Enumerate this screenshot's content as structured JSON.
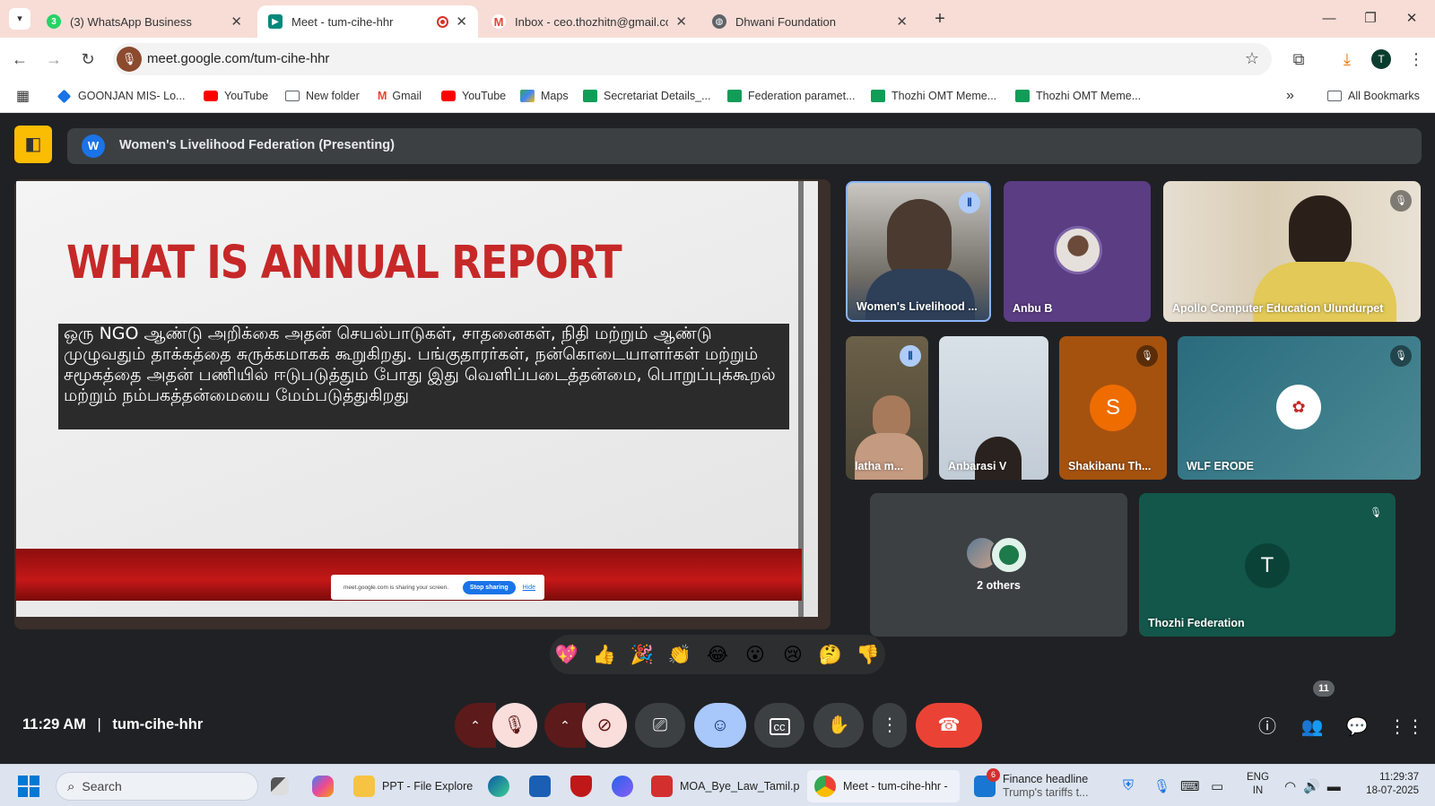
{
  "browser": {
    "tabs": [
      {
        "title": "(3) WhatsApp Business",
        "icon": "whatsapp-icon",
        "color": "#25d366",
        "badge": "3"
      },
      {
        "title": "Meet - tum-cihe-hhr",
        "icon": "google-meet-icon",
        "color": "#00897b"
      },
      {
        "title": "Inbox - ceo.thozhitn@gmail.com",
        "icon": "gmail-icon",
        "color": "#ea4335"
      },
      {
        "title": "Dhwani Foundation",
        "icon": "globe-icon",
        "color": "#5f6368"
      }
    ],
    "url": "meet.google.com/tum-cihe-hhr",
    "profile_initial": "T",
    "bookmarks": [
      {
        "label": "GOONJAN MIS- Lo...",
        "icon": "goonjan-icon",
        "color": "#1a73e8"
      },
      {
        "label": "YouTube",
        "icon": "youtube-icon",
        "color": "#ff0000"
      },
      {
        "label": "New folder",
        "icon": "folder-icon",
        "color": "#5f6368"
      },
      {
        "label": "Gmail",
        "icon": "gmail-icon",
        "color": "#ea4335"
      },
      {
        "label": "YouTube",
        "icon": "youtube-icon",
        "color": "#ff0000"
      },
      {
        "label": "Maps",
        "icon": "maps-icon",
        "color": "#34a853"
      },
      {
        "label": "Secretariat Details_...",
        "icon": "sheets-icon",
        "color": "#0f9d58"
      },
      {
        "label": "Federation paramet...",
        "icon": "sheets-icon",
        "color": "#0f9d58"
      },
      {
        "label": "Thozhi OMT Meme...",
        "icon": "sheets-icon",
        "color": "#0f9d58"
      },
      {
        "label": "Thozhi OMT Meme...",
        "icon": "sheets-icon",
        "color": "#0f9d58"
      }
    ],
    "all_bookmarks": "All Bookmarks"
  },
  "meet": {
    "presenter_initial": "W",
    "presenter_label": "Women's Livelihood Federation (Presenting)",
    "slide": {
      "title": "WHAT IS ANNUAL REPORT",
      "body": "ஒரு NGO ஆண்டு அறிக்கை அதன் செயல்பாடுகள், சாதனைகள், நிதி மற்றும் ஆண்டு முழுவதும் தாக்கத்தை சுருக்கமாகக் கூறுகிறது. பங்குதாரர்கள், நன்கொடையாளர்கள் மற்றும் சமூகத்தை அதன் பணியில் ஈடுபடுத்தும் போது இது வெளிப்படைத்தன்மை, பொறுப்புக்கூறல் மற்றும் நம்பகத்தன்மையை மேம்படுத்துகிறது",
      "share_notice": "meet.google.com is sharing your screen.",
      "stop_sharing": "Stop sharing",
      "hide": "Hide"
    },
    "participants": [
      {
        "name": "Women's Livelihood ...",
        "state": "speaking"
      },
      {
        "name": "Anbu B",
        "state": "none"
      },
      {
        "name": "Apollo Computer Education Ulundurpet",
        "state": "muted"
      },
      {
        "name": "latha m...",
        "state": "speaking"
      },
      {
        "name": "Anbarasi V",
        "state": "none"
      },
      {
        "name": "Shakibanu Th...",
        "initial": "S",
        "state": "muted"
      },
      {
        "name": "WLF ERODE",
        "state": "muted"
      },
      {
        "name": "Thozhi Federation",
        "initial": "T",
        "state": "muted"
      }
    ],
    "others_label": "2 others",
    "reactions": [
      "💖",
      "👍",
      "🎉",
      "👏",
      "😂",
      "😮",
      "😢",
      "🤔",
      "👎"
    ],
    "time": "11:29 AM",
    "meeting_code": "tum-cihe-hhr",
    "people_count": "11"
  },
  "taskbar": {
    "search_placeholder": "Search",
    "apps": [
      {
        "label": "PPT - File Explore",
        "icon": "file-explorer-icon"
      },
      {
        "label": "MOA_Bye_Law_Tamil.p",
        "icon": "wps-pdf-icon"
      },
      {
        "label": "Meet - tum-cihe-hhr -",
        "icon": "chrome-icon"
      }
    ],
    "news_badge": "6",
    "news_title": "Finance headline",
    "news_sub": "Trump's tariffs t...",
    "lang_top": "ENG",
    "lang_bottom": "IN",
    "clock_time": "11:29:37",
    "clock_date": "18-07-2025"
  }
}
